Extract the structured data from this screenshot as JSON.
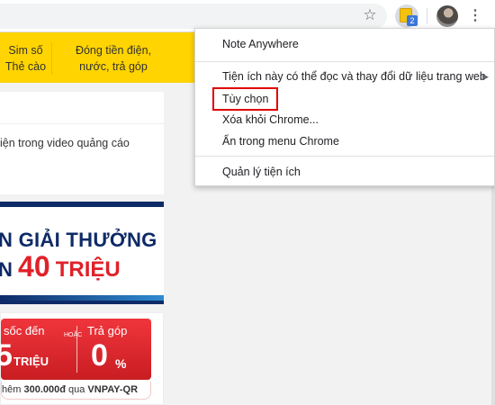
{
  "toolbar": {
    "star_icon": "star-icon",
    "extension_badge": "2",
    "extension_icon": "note-anywhere-icon",
    "menu_icon": "more-vertical-icon"
  },
  "site": {
    "nav": {
      "sim_line1": "Sim số",
      "sim_line2": "Thẻ cào",
      "pay_line1": "Đóng tiền điện,",
      "pay_line2": "nước, trả góp"
    },
    "video_text": "iện trong video quảng cáo",
    "promo": {
      "line1": "N GIẢI THƯỞNG",
      "line2_prefix": "N",
      "amount": "40",
      "unit": "TRIỆU"
    },
    "deal": {
      "left_title": "sốc đến",
      "left_big": "5",
      "left_unit": "TRIỆU",
      "or_text": "HOẶC",
      "right_title": "Trả góp",
      "right_big": "0",
      "right_unit": "%",
      "footer_prefix": "hêm ",
      "footer_amount": "300.000đ",
      "footer_mid": " qua ",
      "footer_brand": "VNPAY-QR"
    }
  },
  "menu": {
    "title": "Note Anywhere",
    "items": [
      "Tiện ích này có thể đọc và thay đổi dữ liệu trang web",
      "Tùy chọn",
      "Xóa khỏi Chrome...",
      "Ẩn trong menu Chrome"
    ],
    "manage": "Quản lý tiện ích",
    "highlight_color": "#e00000"
  }
}
